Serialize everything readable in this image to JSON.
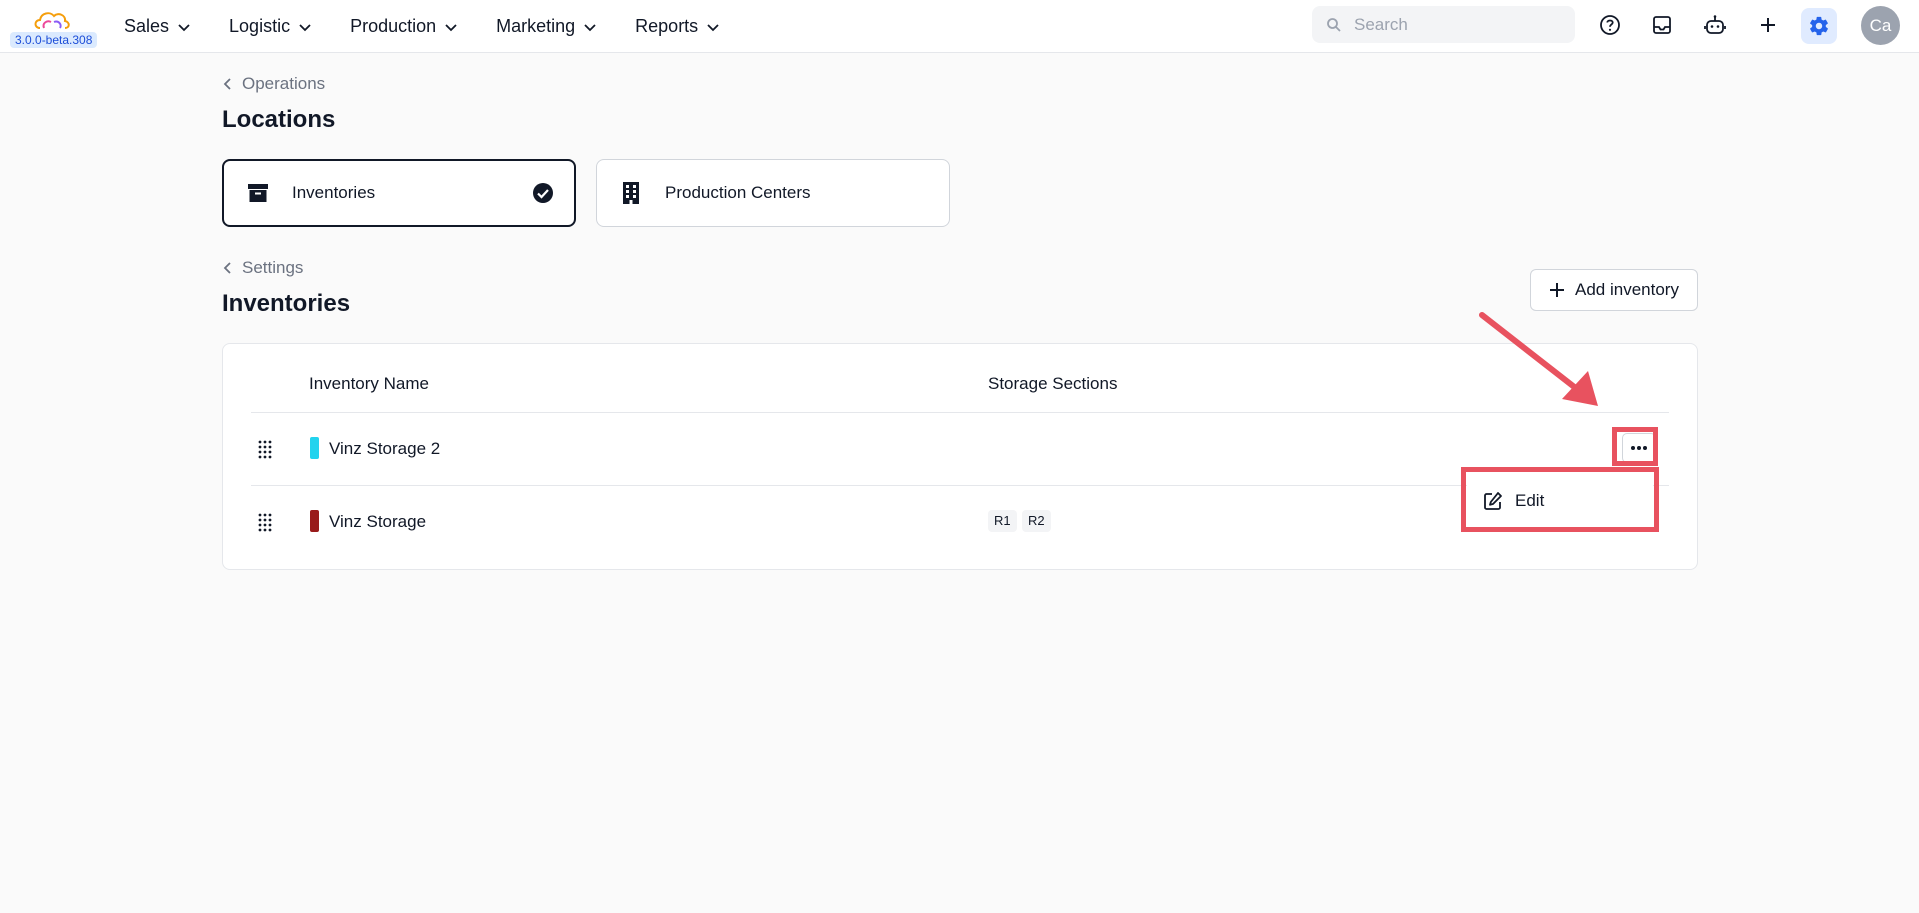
{
  "app": {
    "version": "3.0.0-beta.308"
  },
  "nav": [
    {
      "label": "Sales"
    },
    {
      "label": "Logistic"
    },
    {
      "label": "Production"
    },
    {
      "label": "Marketing"
    },
    {
      "label": "Reports"
    }
  ],
  "search": {
    "placeholder": "Search"
  },
  "user": {
    "initials": "Ca"
  },
  "locations": {
    "breadcrumb": "Operations",
    "title": "Locations",
    "cards": [
      {
        "label": "Inventories",
        "icon": "archive-icon",
        "selected": true
      },
      {
        "label": "Production Centers",
        "icon": "building-icon",
        "selected": false
      }
    ]
  },
  "inventories": {
    "breadcrumb": "Settings",
    "title": "Inventories",
    "add_label": "Add inventory",
    "columns": [
      "Inventory Name",
      "Storage Sections"
    ],
    "rows": [
      {
        "name": "Vinz Storage 2",
        "color": "#22d3ee",
        "sections": []
      },
      {
        "name": "Vinz Storage",
        "color": "#991b1b",
        "sections": [
          "R1",
          "R2"
        ]
      }
    ]
  },
  "row_menu": {
    "edit_label": "Edit"
  },
  "colors": {
    "accent": "#2563eb",
    "highlight": "#e8525f"
  }
}
